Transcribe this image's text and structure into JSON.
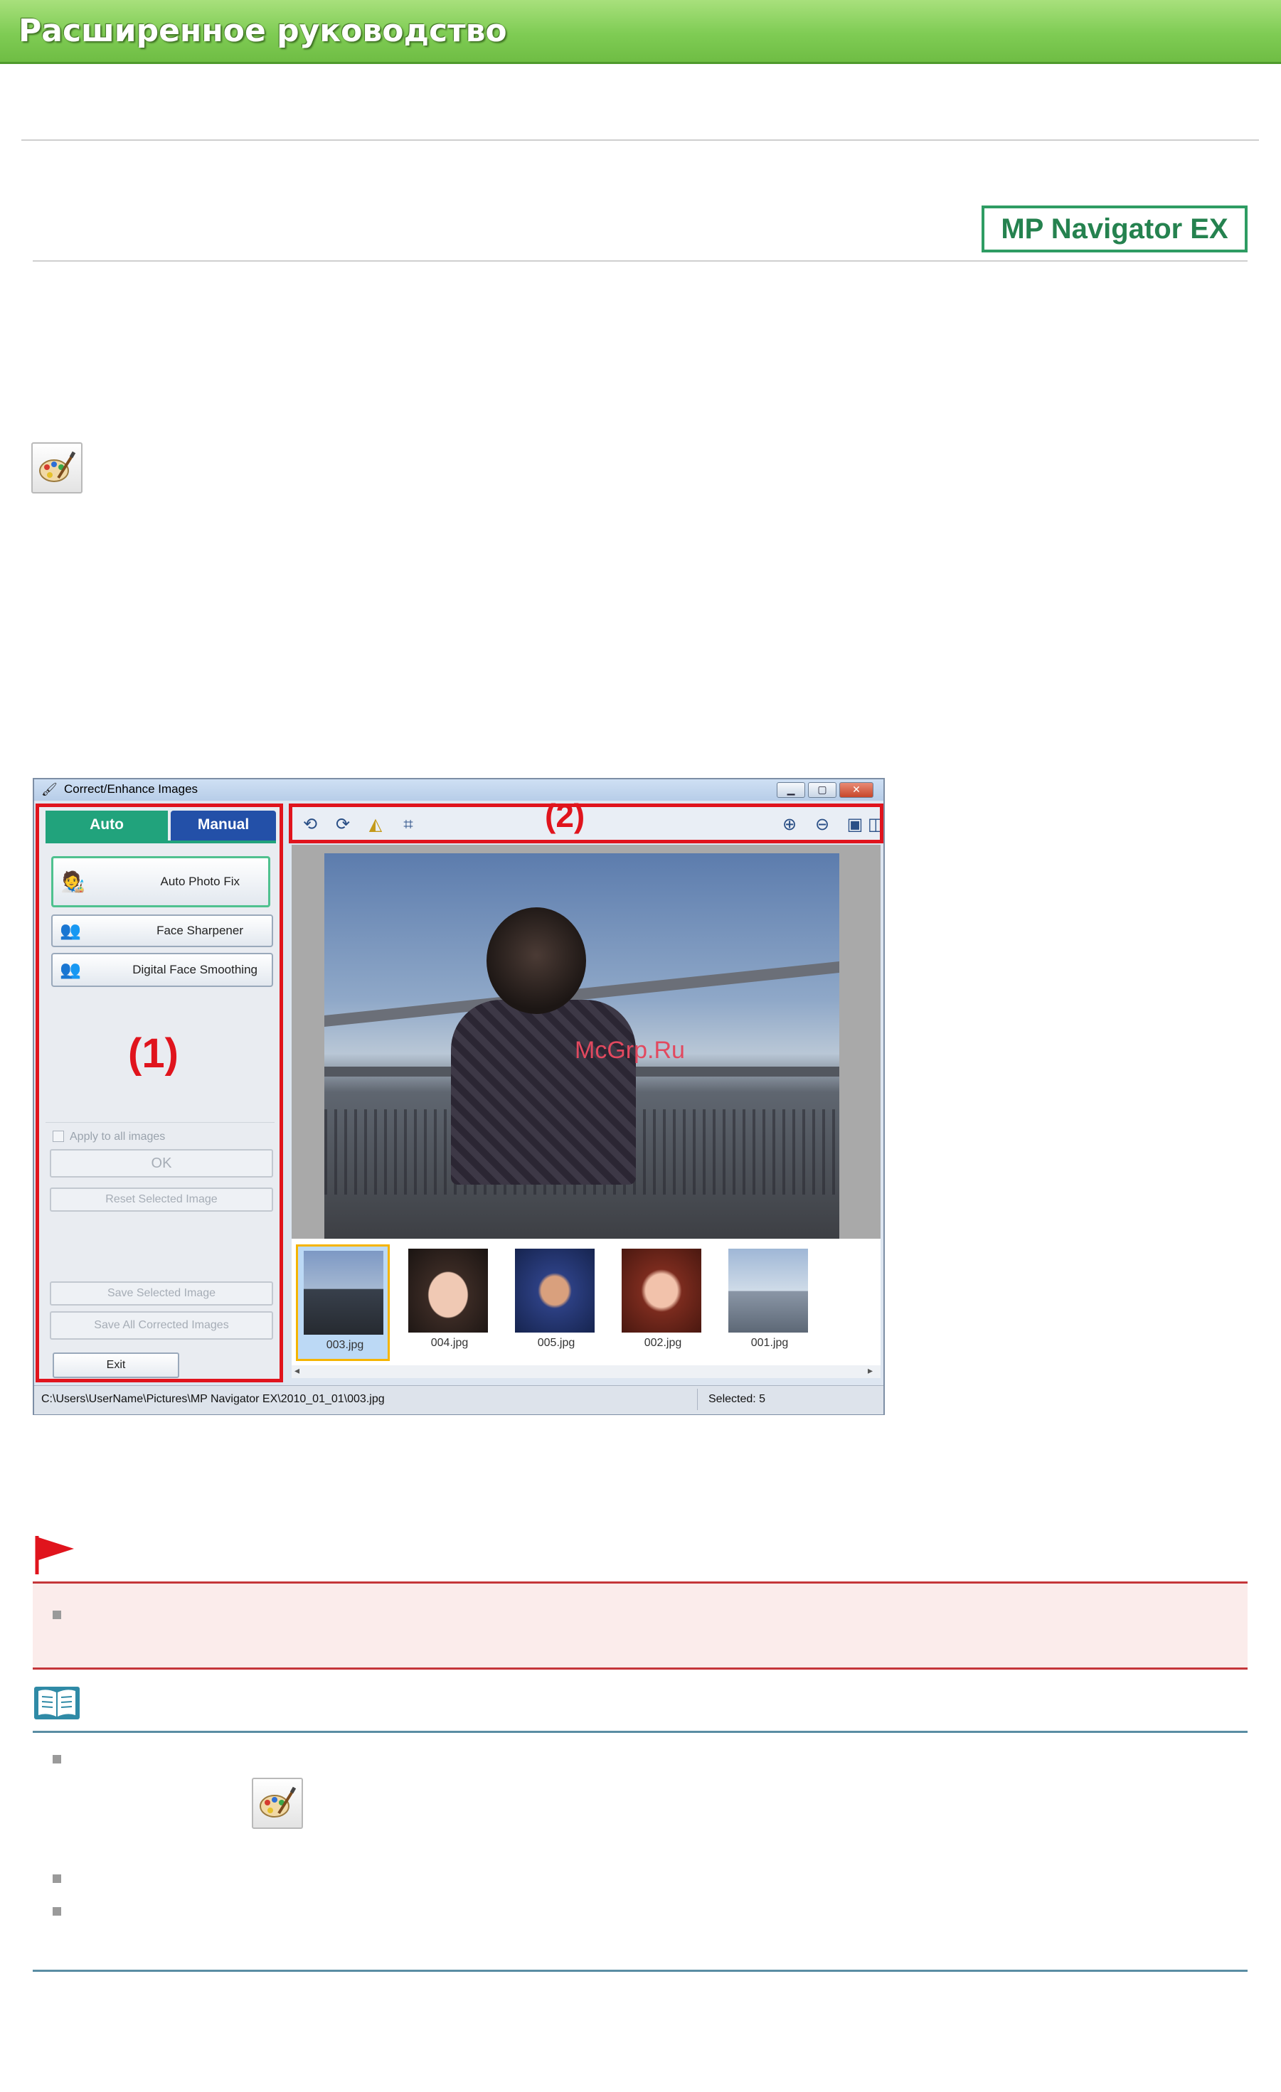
{
  "header": {
    "banner_title": "Расширенное руководство",
    "badge": "MP Navigator EX"
  },
  "icons": {
    "correct_enhance": "palette-brush-icon",
    "important": "red-flag-icon",
    "note": "open-book-icon"
  },
  "colors": {
    "banner_green": "#7fcc54",
    "badge_green": "#2e9c63",
    "highlight_red": "#e0141d",
    "important_bg": "#fbeceb",
    "important_rule": "#c5363a",
    "note_rule": "#5a8da3"
  },
  "dialog": {
    "title": "Correct/Enhance Images",
    "tabs": {
      "auto": "Auto",
      "manual": "Manual"
    },
    "buttons": {
      "auto_photo_fix": "Auto Photo Fix",
      "face_sharpener": "Face Sharpener",
      "digital_face_smoothing": "Digital Face Smoothing",
      "ok": "OK",
      "reset_selected": "Reset Selected Image",
      "save_selected": "Save Selected Image",
      "save_all": "Save All Corrected Images",
      "exit": "Exit"
    },
    "apply_all_label": "Apply to all images",
    "labels": {
      "area1": "(1)",
      "area2": "(2)"
    },
    "watermark": "McGrp.Ru",
    "thumbnails": [
      {
        "name": "003.jpg",
        "selected": true
      },
      {
        "name": "004.jpg",
        "selected": false
      },
      {
        "name": "005.jpg",
        "selected": false
      },
      {
        "name": "002.jpg",
        "selected": false
      },
      {
        "name": "001.jpg",
        "selected": false
      }
    ],
    "status": {
      "path": "C:\\Users\\UserName\\Pictures\\MP Navigator EX\\2010_01_01\\003.jpg",
      "selected": "Selected: 5"
    }
  }
}
